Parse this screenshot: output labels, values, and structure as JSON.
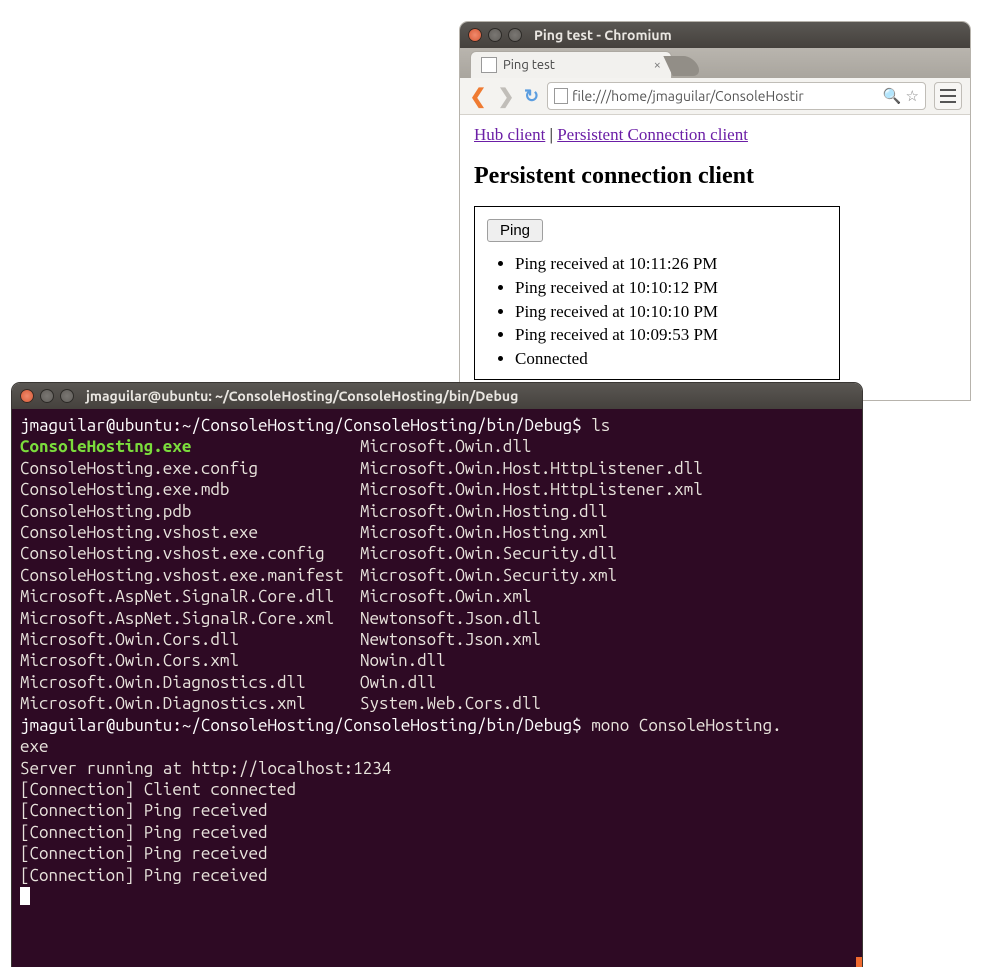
{
  "browser": {
    "window_title": "Ping test - Chromium",
    "tab_label": "Ping test",
    "url": "file:///home/jmaguilar/ConsoleHostir",
    "links": {
      "hub": "Hub client",
      "sep": " | ",
      "persistent": "Persistent Connection client"
    },
    "heading": "Persistent connection client",
    "ping_button": "Ping",
    "log": [
      "Ping received at 10:11:26 PM",
      "Ping received at 10:10:12 PM",
      "Ping received at 10:10:10 PM",
      "Ping received at 10:09:53 PM",
      "Connected"
    ]
  },
  "terminal": {
    "title": "jmaguilar@ubuntu: ~/ConsoleHosting/ConsoleHosting/bin/Debug",
    "prompt1": "jmaguilar@ubuntu:~/ConsoleHosting/ConsoleHosting/bin/Debug$ ",
    "cmd1": "ls",
    "ls_col1": [
      "ConsoleHosting.exe",
      "ConsoleHosting.exe.config",
      "ConsoleHosting.exe.mdb",
      "ConsoleHosting.pdb",
      "ConsoleHosting.vshost.exe",
      "ConsoleHosting.vshost.exe.config",
      "ConsoleHosting.vshost.exe.manifest",
      "Microsoft.AspNet.SignalR.Core.dll",
      "Microsoft.AspNet.SignalR.Core.xml",
      "Microsoft.Owin.Cors.dll",
      "Microsoft.Owin.Cors.xml",
      "Microsoft.Owin.Diagnostics.dll",
      "Microsoft.Owin.Diagnostics.xml"
    ],
    "ls_col2": [
      "Microsoft.Owin.dll",
      "Microsoft.Owin.Host.HttpListener.dll",
      "Microsoft.Owin.Host.HttpListener.xml",
      "Microsoft.Owin.Hosting.dll",
      "Microsoft.Owin.Hosting.xml",
      "Microsoft.Owin.Security.dll",
      "Microsoft.Owin.Security.xml",
      "Microsoft.Owin.xml",
      "Newtonsoft.Json.dll",
      "Newtonsoft.Json.xml",
      "Nowin.dll",
      "Owin.dll",
      "System.Web.Cors.dll"
    ],
    "cmd2": "mono ConsoleHosting.",
    "cmd2b": "exe",
    "output": [
      "Server running at http://localhost:1234",
      "[Connection] Client connected",
      "[Connection] Ping received",
      "[Connection] Ping received",
      "[Connection] Ping received",
      "[Connection] Ping received"
    ]
  }
}
